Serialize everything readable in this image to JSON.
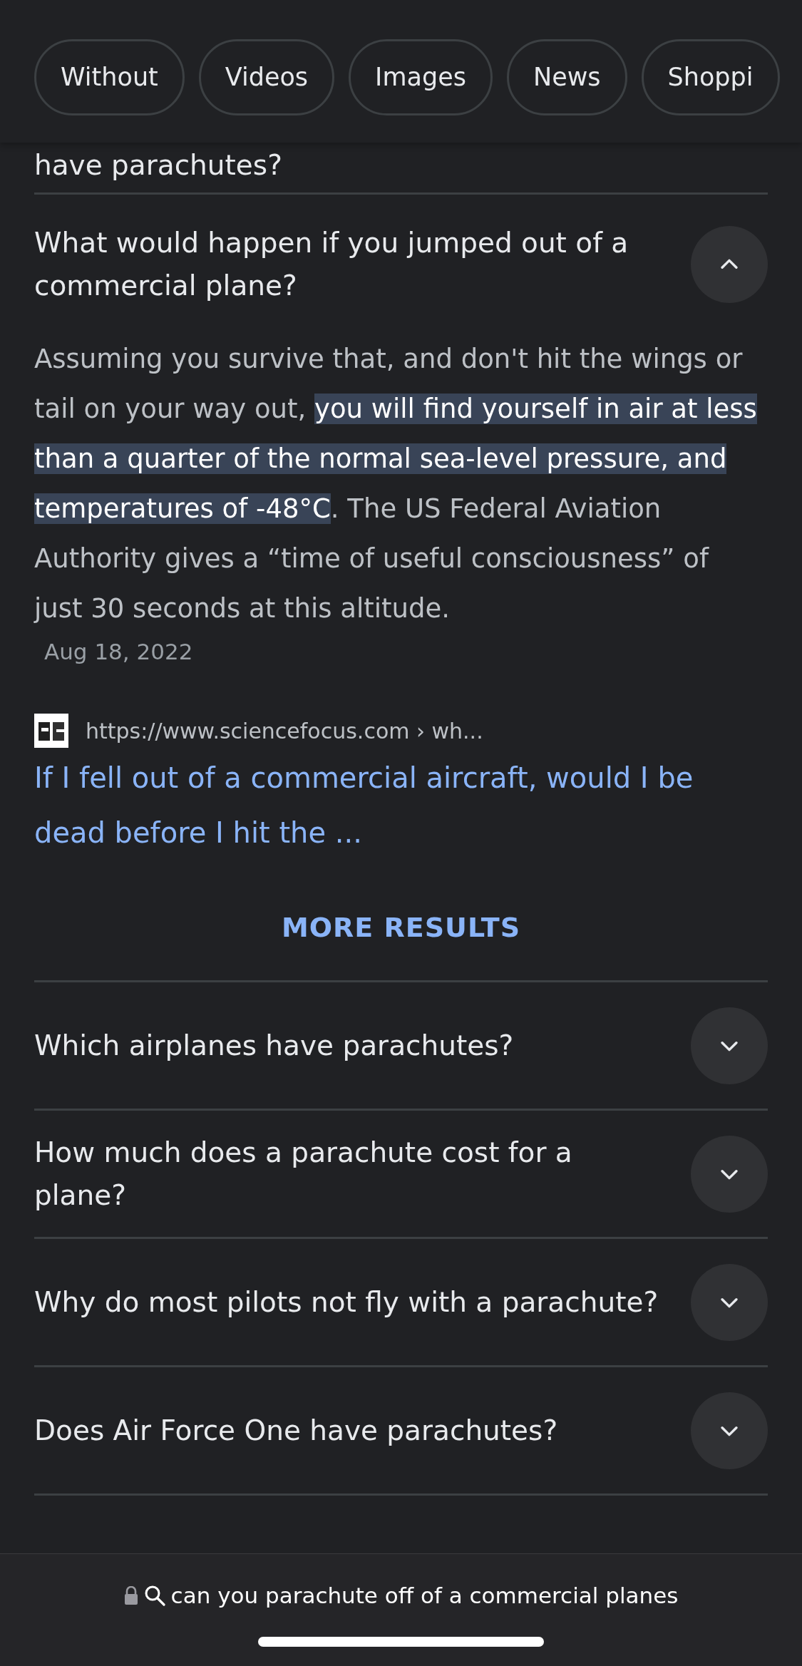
{
  "filter_chips": [
    {
      "label": "Without"
    },
    {
      "label": "Videos"
    },
    {
      "label": "Images"
    },
    {
      "label": "News"
    },
    {
      "label": "Shoppi"
    }
  ],
  "questions": [
    {
      "question": "have parachutes?"
    },
    {
      "question": "What would happen if you jumped out of a commercial plane?",
      "expanded": true,
      "answer": {
        "text": "Assuming you survive that, and don't hit the wings or tail on your way out, **you will find yourself in air at less than a quarter of the normal sea-level pressure, and temperatures of -48°C**. The US Federal Aviation Authority gives a “time of useful consciousness” of just 30 seconds at this altitude.",
        "date": "Aug 18, 2022"
      },
      "source": {
        "url": "https://www.sciencefocus.com › wh...",
        "title": "If I fell out of a commercial aircraft, would I be dead before I hit the ..."
      },
      "more_results": "MORE RESULTS"
    },
    {
      "question": "Which airplanes have parachutes?",
      "expanded": false
    },
    {
      "question": "How much does a parachute cost for a plane?",
      "expanded": false
    },
    {
      "question": "Why do most pilots not fly with a parachute?",
      "expanded": false
    },
    {
      "question": "Does Air Force One have parachutes?",
      "expanded": false
    }
  ],
  "address_bar": {
    "text": "can you parachute off of a commercial planes"
  }
}
